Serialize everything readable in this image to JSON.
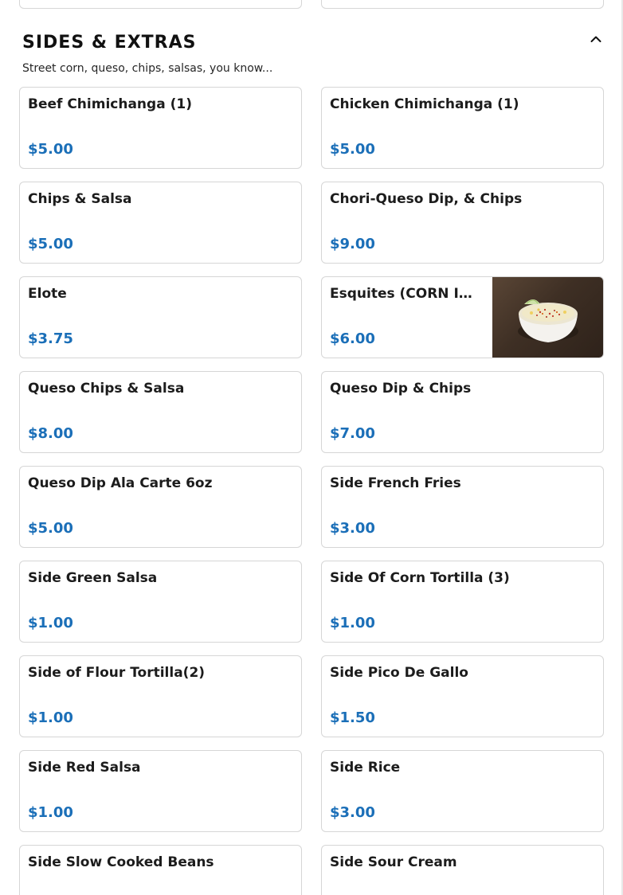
{
  "section": {
    "title": "SIDES & EXTRAS",
    "description": "Street corn, queso, chips, salsas, you know..."
  },
  "icons": {
    "collapse": "chevron-up-icon"
  },
  "colors": {
    "price": "#1b6fb8",
    "border": "#d6d6d6"
  },
  "items": [
    {
      "name": "Beef Chimichanga (1)",
      "price": "$5.00"
    },
    {
      "name": "Chicken Chimichanga (1)",
      "price": "$5.00"
    },
    {
      "name": "Chips & Salsa",
      "price": "$5.00"
    },
    {
      "name": "Chori-Queso Dip, & Chips",
      "price": "$9.00"
    },
    {
      "name": "Elote",
      "price": "$3.75"
    },
    {
      "name": "Esquites (CORN IN...",
      "price": "$6.00",
      "image": "esquites-cup-photo"
    },
    {
      "name": "Queso Chips & Salsa",
      "price": "$8.00"
    },
    {
      "name": "Queso Dip & Chips",
      "price": "$7.00"
    },
    {
      "name": "Queso Dip Ala Carte 6oz",
      "price": "$5.00"
    },
    {
      "name": "Side French Fries",
      "price": "$3.00"
    },
    {
      "name": "Side Green Salsa",
      "price": "$1.00"
    },
    {
      "name": "Side Of Corn Tortilla (3)",
      "price": "$1.00"
    },
    {
      "name": "Side of Flour Tortilla(2)",
      "price": "$1.00"
    },
    {
      "name": "Side Pico De Gallo",
      "price": "$1.50"
    },
    {
      "name": "Side Red Salsa",
      "price": "$1.00"
    },
    {
      "name": "Side Rice",
      "price": "$3.00"
    },
    {
      "name": "Side Slow Cooked Beans",
      "price": ""
    },
    {
      "name": "Side Sour Cream",
      "price": ""
    }
  ]
}
